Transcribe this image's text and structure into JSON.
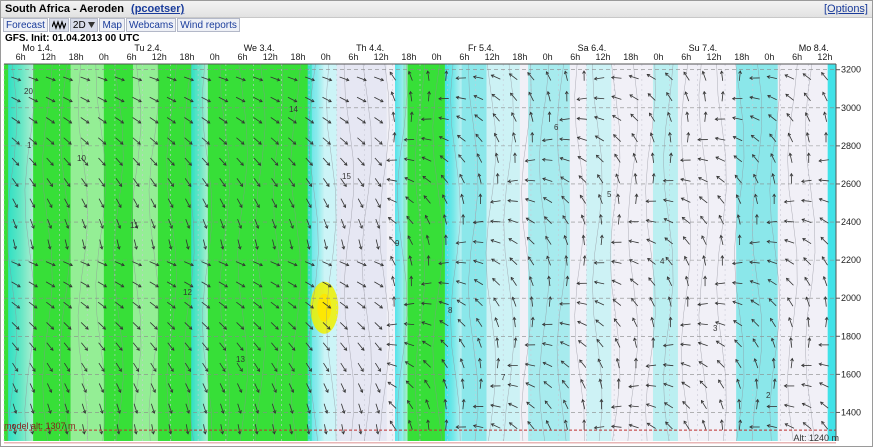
{
  "header": {
    "title": "South Africa - Aeroden",
    "user_link": "(pcoetser)",
    "options_link": "[Options]"
  },
  "tabs": [
    {
      "label": "Forecast",
      "active": false
    },
    {
      "label": "",
      "icon": "wave-icon",
      "active": true
    },
    {
      "label": "2D",
      "icon": "dropdown-arrow-icon",
      "active": true
    },
    {
      "label": "Map",
      "active": false
    },
    {
      "label": "Webcams",
      "active": false
    },
    {
      "label": "Wind reports",
      "active": false
    }
  ],
  "init_text": "GFS, Init: 01.04.2013 00 UTC",
  "model_altitude_text": "model alt: 1307 m",
  "altitude_text": "Alt: 1240 m",
  "colors": {
    "link": "#1a3c9b",
    "model_line": "#c03030",
    "low_speed": "#f1f0f7",
    "mid_speed": "#6fe0e4",
    "high_speed": "#22dd22",
    "max_speed": "#eef000"
  },
  "chart_data": {
    "type": "heatmap",
    "day_labels": [
      "Mo 1.4.",
      "Tu 2.4.",
      "We 3.4.",
      "Th 4.4.",
      "Fr 5.4.",
      "Sa 6.4.",
      "Su 7.4.",
      "Mo 8.4."
    ],
    "hour_labels": [
      "6h",
      "12h",
      "18h",
      "0h",
      "6h",
      "12h",
      "18h",
      "0h",
      "6h",
      "12h",
      "18h",
      "0h",
      "6h",
      "12h",
      "18h",
      "0h",
      "6h",
      "12h",
      "18h",
      "0h",
      "6h",
      "12h",
      "18h",
      "0h",
      "6h",
      "12h",
      "18h",
      "0h",
      "6h",
      "12h"
    ],
    "altitude_ticks": [
      3200,
      3000,
      2800,
      2600,
      2400,
      2200,
      2000,
      1800,
      1600,
      1400
    ],
    "ylim": [
      1250,
      3230
    ],
    "contour_labels": [
      "20",
      "10",
      "11",
      "12",
      "13",
      "14",
      "15",
      "9",
      "8",
      "7",
      "6",
      "5",
      "4",
      "3",
      "2",
      "1"
    ],
    "model_altitude_m": 1307,
    "altitude_m": 1240
  }
}
